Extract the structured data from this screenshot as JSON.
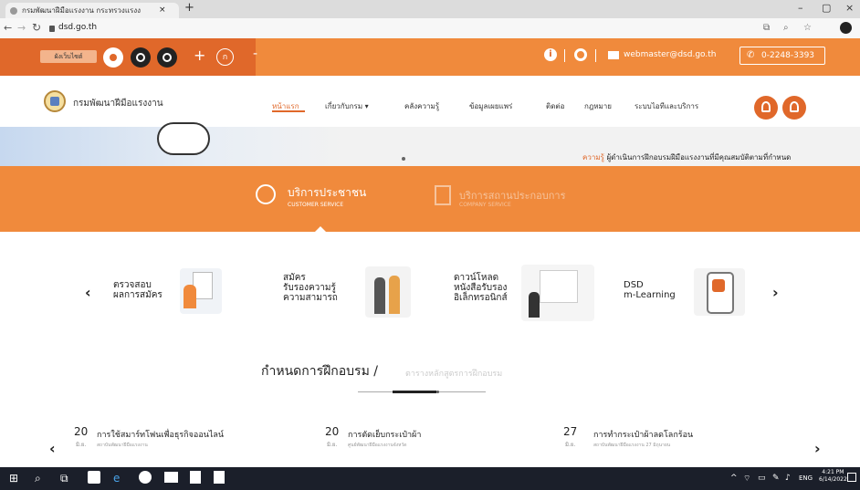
{
  "browser": {
    "tab_title": "กรมพัฒนาฝีมือแรงงาน กระทรวงแรงงาน",
    "tab_close": "×",
    "new_tab": "+",
    "url": "dsd.go.th",
    "win_minimize": "–",
    "win_restore": "▢",
    "win_close": "×"
  },
  "topbar": {
    "sitemap": "ผังเว็บไซต์",
    "font_plus": "+",
    "font_normal": "ก",
    "font_minus": "-",
    "info": "i",
    "email": "webmaster@dsd.go.th",
    "phone": "0-2248-3393"
  },
  "header": {
    "site_name": "กรมพัฒนาฝีมือแรงงาน",
    "nav": [
      {
        "label": "หน้าแรก"
      },
      {
        "label": "เกี่ยวกับกรม ▾"
      },
      {
        "label": "คลังความรู้"
      },
      {
        "label": "ข้อมูลเผยแพร่"
      },
      {
        "label": "ติดต่อ"
      },
      {
        "label": "กฎหมาย"
      },
      {
        "label": "ระบบไอทีและบริการ"
      }
    ]
  },
  "banner": {
    "ticker_highlight": "ความรู้",
    "ticker": " ผู้ดำเนินการฝึกอบรมฝีมือแรงงานที่มีคุณสมบัติตามที่กำหนด"
  },
  "services": {
    "tab1_title": "บริการประชาชน",
    "tab1_sub": "CUSTOMER SERVICE",
    "tab2_title": "บริการสถานประกอบการ",
    "tab2_sub": "COMPANY SERVICE"
  },
  "carousel": {
    "prev": "‹",
    "next": "›",
    "items": [
      {
        "title": "ตรวจสอบ\nผลการสมัคร"
      },
      {
        "title": "สมัคร\nรับรองความรู้\nความสามารถ"
      },
      {
        "title": "ดาวน์โหลด\nหนังสือรับรอง\nอิเล็กทรอนิกส์"
      },
      {
        "title": "DSD\nm-Learning"
      }
    ]
  },
  "schedule": {
    "title": "กำหนดการฝึกอบรม /",
    "subtitle": "ตารางหลักสูตรการฝึกอบรม",
    "prev": "‹",
    "next": "›",
    "events": [
      {
        "day": "20",
        "month": "มิ.ย.",
        "title": "การใช้สมาร์ทโฟนเพื่อธุรกิจออนไลน์",
        "desc": "สถาบันพัฒนาฝีมือแรงงาน"
      },
      {
        "day": "20",
        "month": "มิ.ย.",
        "title": "การตัดเย็บกระเป๋าผ้า",
        "desc": "ศูนย์พัฒนาฝีมือแรงงานจังหวัด"
      },
      {
        "day": "27",
        "month": "มิ.ย.",
        "title": "การทำกระเป๋าผ้าลดโลกร้อน",
        "desc": "สถาบันพัฒนาฝีมือแรงงาน 27 มิถุนายน"
      }
    ]
  },
  "taskbar": {
    "start": "⊞",
    "search": "⌕",
    "lang": "ENG",
    "time": "4:21 PM",
    "date": "6/14/2022"
  }
}
